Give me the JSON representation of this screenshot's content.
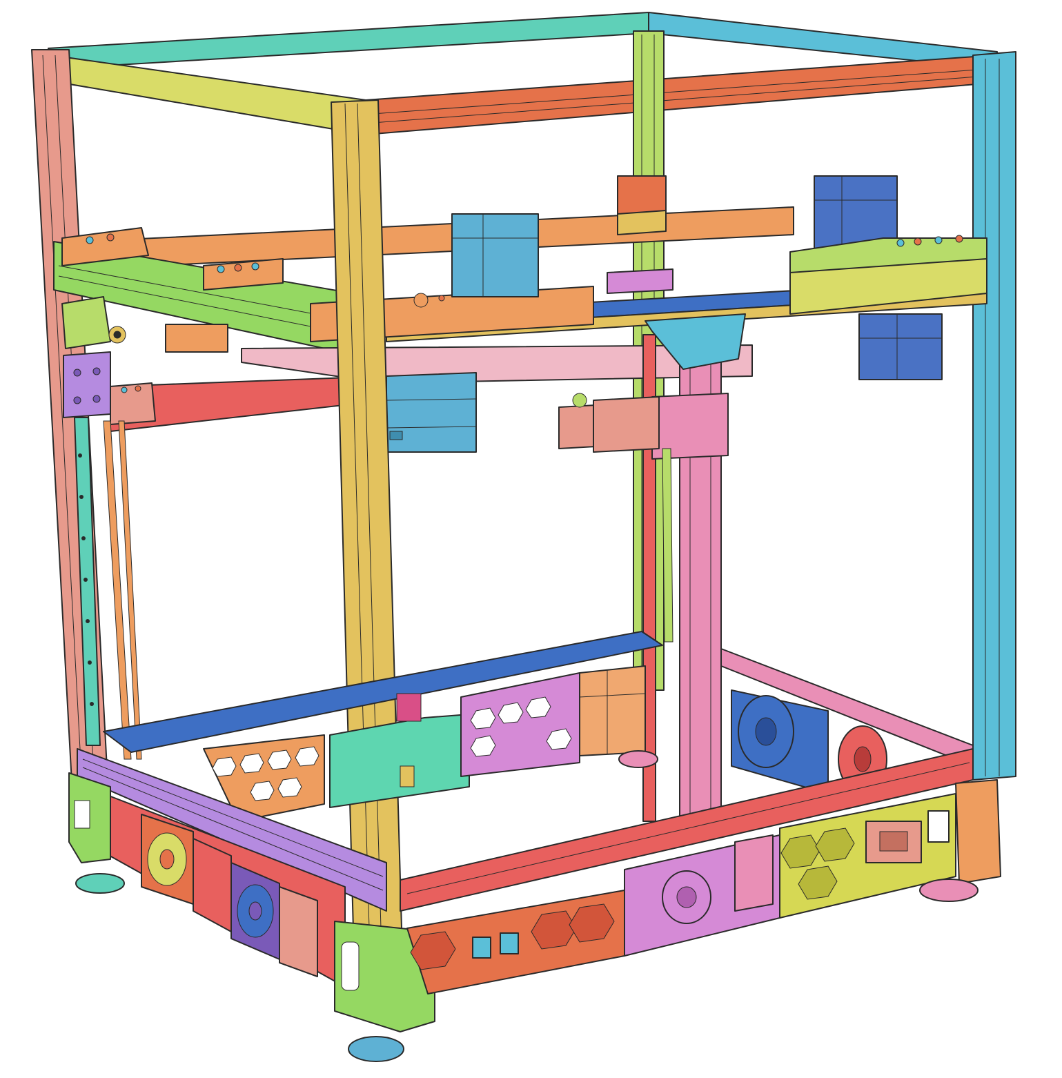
{
  "scene": {
    "subject": "",
    "colors": {
      "background": "#ffffff",
      "outline": "#2a2a2a",
      "salmon": "#e79a8c",
      "yellow_green": "#d9dc68",
      "teal": "#5fd0b8",
      "cyan": "#5bbfd8",
      "orange_red": "#e5724a",
      "gold": "#e3c25e",
      "lime": "#b7dc6a",
      "green": "#95d862",
      "purple": "#a388e0",
      "lavender": "#b58be0",
      "pink": "#e98fb6",
      "red": "#e8605e",
      "orange": "#ee9d5f",
      "blue": "#3e6fc4",
      "motor_blue": "#5eb1d4",
      "motor_dark_blue": "#4a72c4",
      "magenta": "#d94f87",
      "mint": "#5ed6b0",
      "rose": "#f0b9c6",
      "olive": "#d6d854",
      "peach": "#f0a870",
      "violet_pink": "#d58ad6"
    }
  }
}
